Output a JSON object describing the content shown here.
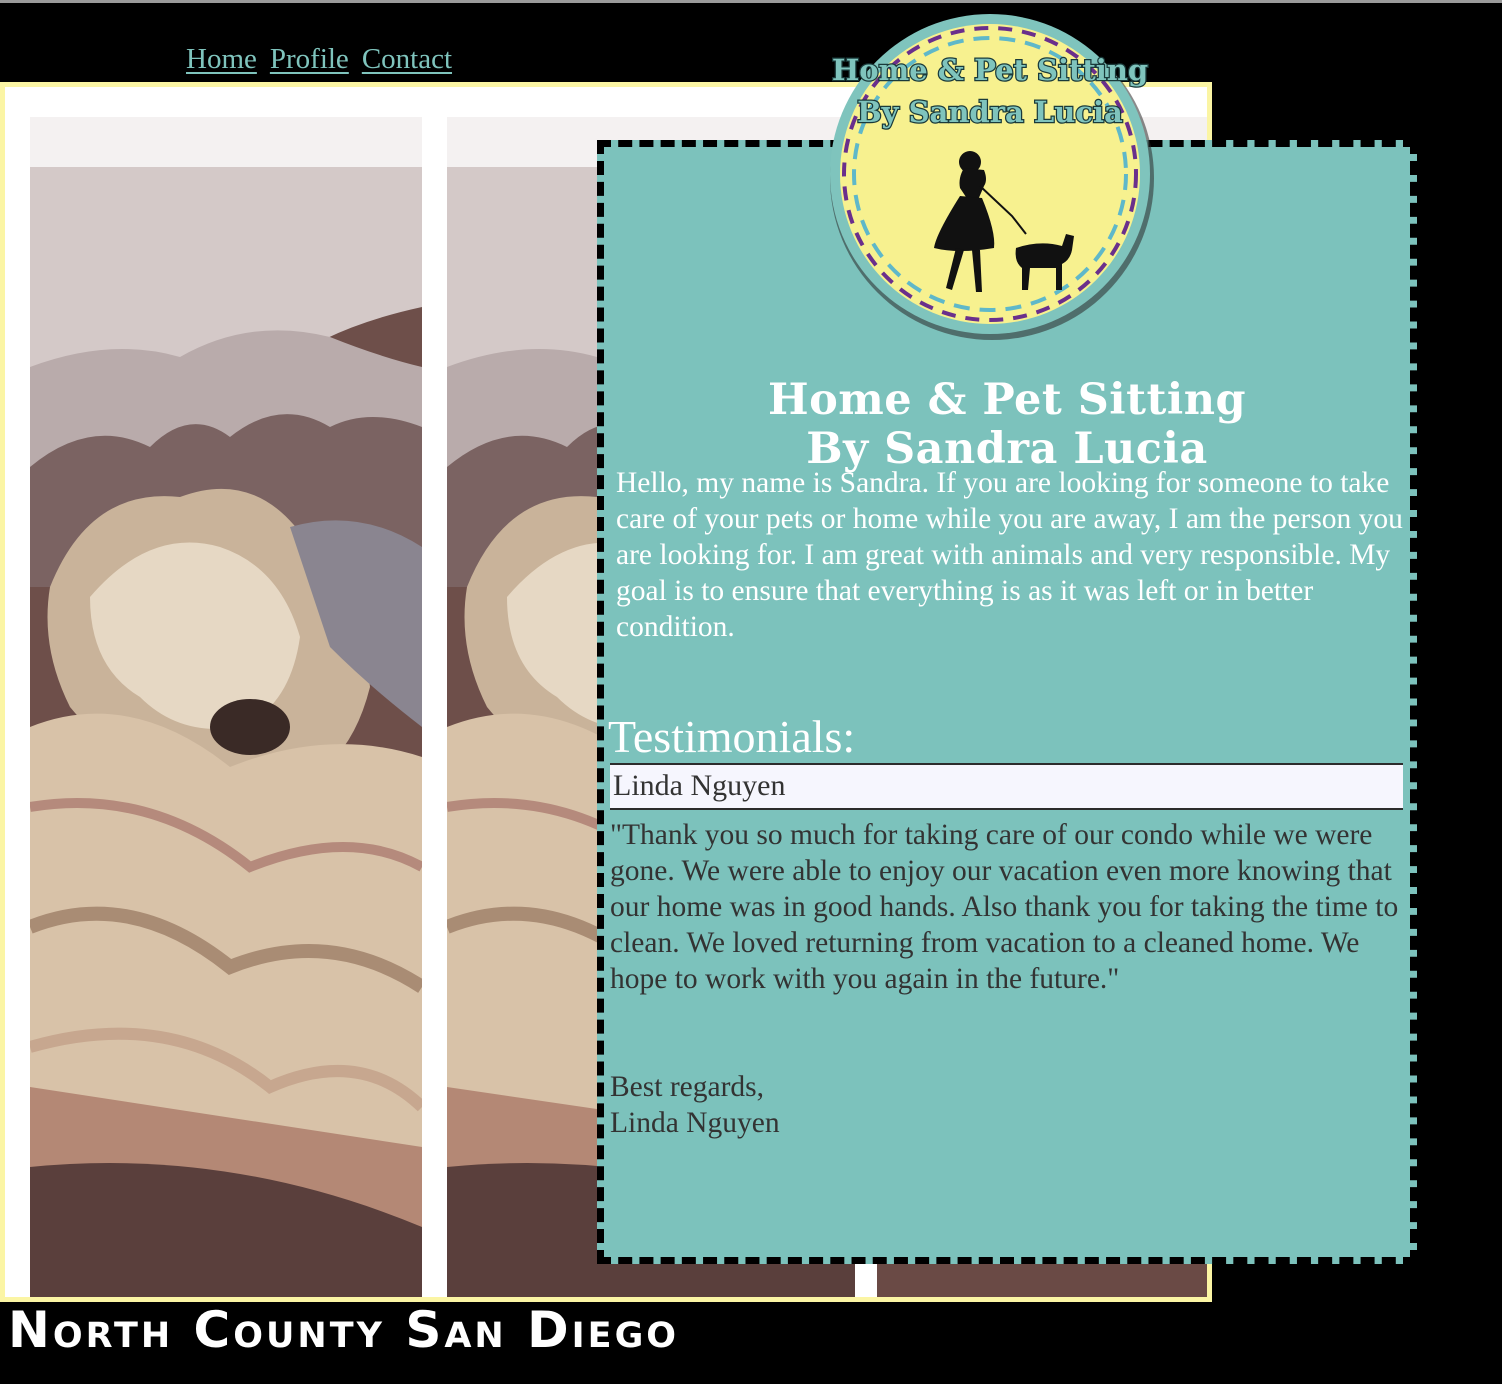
{
  "nav": {
    "items": [
      {
        "label": "Home"
      },
      {
        "label": "Profile"
      },
      {
        "label": "Contact"
      }
    ]
  },
  "logo": {
    "line1": "Home & Pet Sitting",
    "line2": "By Sandra Lucia"
  },
  "main": {
    "title_line1": "Home & Pet Sitting",
    "title_line2": "By Sandra Lucia",
    "intro": "Hello, my name is Sandra. If you are looking for someone to take care of your pets or home while you are away, I am the person you are looking for. I am great with animals and very responsible. My goal is to ensure that everything is as it was left or in better condition."
  },
  "testimonials": {
    "heading": "Testimonials:",
    "items": [
      {
        "name": "Linda Nguyen",
        "text": "\"Thank you so much for taking care of our condo while we were gone. We were able to enjoy our vacation even more knowing that our home was in good hands. Also thank you for taking the time to clean. We loved returning from vacation to a cleaned home. We hope to work with you again in the future.\"",
        "closing": "Best regards,",
        "signature": "Linda Nguyen"
      }
    ]
  },
  "footer": {
    "region": "North County San Diego"
  },
  "colors": {
    "background": "#000000",
    "panel": "#7cc2bc",
    "frame_border": "#fbf5a4",
    "nav_link": "#7fc4bd",
    "logo_fill": "#f7f18f",
    "logo_dash_purple": "#6a2f8c"
  },
  "images": {
    "gallery": "sleeping-yorkshire-terrier-photo",
    "logo_figure": "woman-walking-dog-silhouette"
  }
}
